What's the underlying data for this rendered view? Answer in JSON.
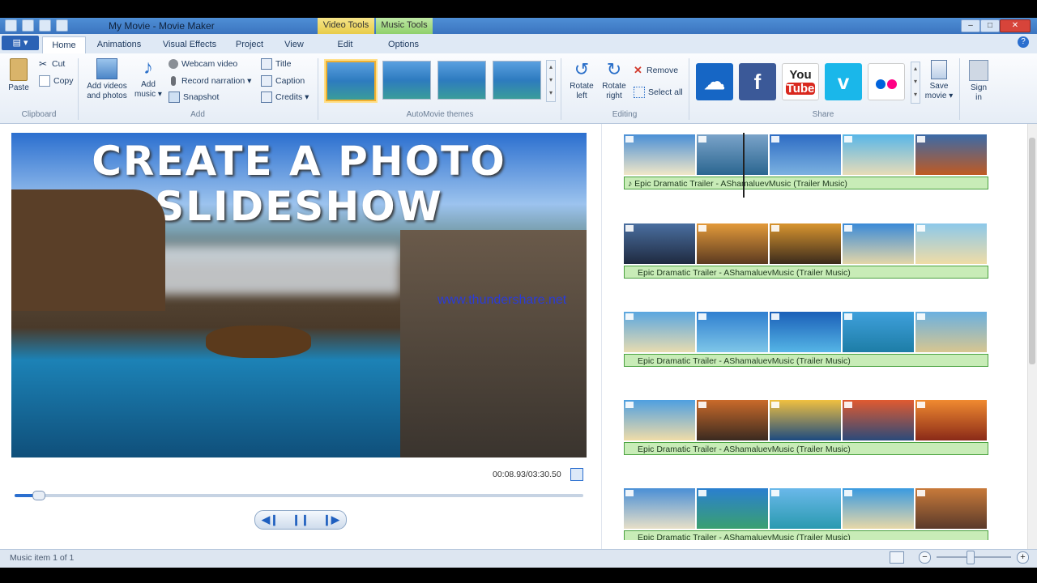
{
  "window": {
    "title": "My Movie - Movie Maker",
    "context_tabs": {
      "video_tools": "Video Tools",
      "music_tools": "Music Tools"
    },
    "controls": {
      "minimize": "–",
      "maximize": "□",
      "close": "✕"
    }
  },
  "tabs": [
    {
      "label": "Home",
      "active": true
    },
    {
      "label": "Animations"
    },
    {
      "label": "Visual Effects"
    },
    {
      "label": "Project"
    },
    {
      "label": "View"
    },
    {
      "label": "Edit"
    },
    {
      "label": "Options"
    }
  ],
  "ribbon": {
    "clipboard": {
      "label": "Clipboard",
      "paste": "Paste",
      "cut": "Cut",
      "copy": "Copy"
    },
    "add": {
      "label": "Add",
      "add_videos_1": "Add videos",
      "add_videos_2": "and photos",
      "add_music_1": "Add",
      "add_music_2": "music ▾",
      "webcam": "Webcam video",
      "narration": "Record narration ▾",
      "snapshot": "Snapshot",
      "title": "Title",
      "caption": "Caption",
      "credits": "Credits ▾"
    },
    "themes": {
      "label": "AutoMovie themes"
    },
    "editing": {
      "label": "Editing",
      "rotate_left_1": "Rotate",
      "rotate_left_2": "left",
      "rotate_right_1": "Rotate",
      "rotate_right_2": "right",
      "remove": "Remove",
      "select_all": "Select all"
    },
    "share": {
      "label": "Share",
      "services": [
        "onedrive",
        "facebook",
        "youtube",
        "vimeo",
        "flickr"
      ],
      "youtube_text_1": "You",
      "youtube_text_2": "Tube",
      "save_movie_1": "Save",
      "save_movie_2": "movie ▾",
      "sign_in_1": "Sign",
      "sign_in_2": "in"
    }
  },
  "preview": {
    "title_line1": "CREATE A PHOTO",
    "title_line2": "SLIDESHOW",
    "watermark": "www.thundershare.net",
    "time": "00:08.93/03:30.50",
    "progress": 0.042
  },
  "storyboard": {
    "music_label": "Epic Dramatic Trailer - AShamaluevMusic (Trailer Music)",
    "first_music_label": "♪ Epic Dramatic Trailer - AShamaluevMusic (Trailer Music)"
  },
  "status": {
    "text": "Music item 1 of 1",
    "zoom": 0.45
  }
}
